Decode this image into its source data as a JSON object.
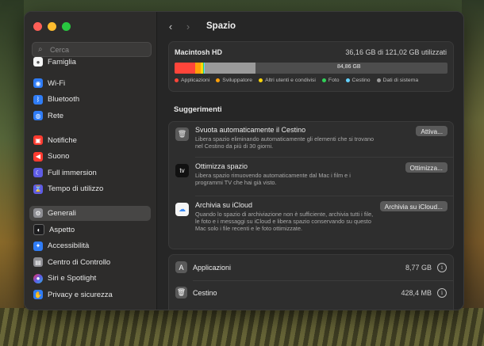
{
  "sidebar": {
    "search_placeholder": "Cerca",
    "items": [
      {
        "label": "Famiglia",
        "icon": "family-icon",
        "color": "#f5f5f5",
        "glyph": "👥"
      },
      {
        "label": "Wi-Fi",
        "icon": "wifi-icon",
        "color": "#2f7cf6",
        "glyph": "◉"
      },
      {
        "label": "Bluetooth",
        "icon": "bluetooth-icon",
        "color": "#2f7cf6",
        "glyph": "ᛒ"
      },
      {
        "label": "Rete",
        "icon": "network-icon",
        "color": "#2f7cf6",
        "glyph": "◍"
      },
      {
        "label": "Notifiche",
        "icon": "notifications-icon",
        "color": "#ff3b30",
        "glyph": "▣"
      },
      {
        "label": "Suono",
        "icon": "sound-icon",
        "color": "#ff3b30",
        "glyph": "◀"
      },
      {
        "label": "Full immersion",
        "icon": "focus-icon",
        "color": "#5e5ce6",
        "glyph": "☾"
      },
      {
        "label": "Tempo di utilizzo",
        "icon": "screen-time-icon",
        "color": "#5e5ce6",
        "glyph": "⌛"
      },
      {
        "label": "Generali",
        "icon": "gear-icon",
        "color": "#8e8e93",
        "glyph": "⚙"
      },
      {
        "label": "Aspetto",
        "icon": "appearance-icon",
        "color": "#1c1c1e",
        "glyph": "◐"
      },
      {
        "label": "Accessibilità",
        "icon": "accessibility-icon",
        "color": "#2f7cf6",
        "glyph": "♿"
      },
      {
        "label": "Centro di Controllo",
        "icon": "control-center-icon",
        "color": "#8e8e93",
        "glyph": "▤"
      },
      {
        "label": "Siri e Spotlight",
        "icon": "siri-icon",
        "color": "#b44cd6",
        "glyph": "●"
      },
      {
        "label": "Privacy e sicurezza",
        "icon": "privacy-icon",
        "color": "#2f7cf6",
        "glyph": "✋"
      }
    ]
  },
  "header": {
    "title": "Spazio"
  },
  "disk": {
    "name": "Macintosh HD",
    "usage": "36,16 GB di 121,02 GB utilizzati",
    "free_label": "84,86 GB",
    "segments": [
      {
        "name": "Applicazioni",
        "color": "#ff453a",
        "fraction": 0.075
      },
      {
        "name": "Sviluppatore",
        "color": "#ff9f0a",
        "fraction": 0.022
      },
      {
        "name": "Altri utenti e condivisi",
        "color": "#ffd60a",
        "fraction": 0.008
      },
      {
        "name": "Foto",
        "color": "#30d158",
        "fraction": 0.002
      },
      {
        "name": "Cestino",
        "color": "#64d2ff",
        "fraction": 0.004
      },
      {
        "name": "Dati di sistema",
        "color": "#9a9a9a",
        "fraction": 0.187
      }
    ]
  },
  "suggestions": {
    "title": "Suggerimenti",
    "items": [
      {
        "title": "Svuota automaticamente il Cestino",
        "desc": "Libera spazio eliminando automaticamente gli elementi che si trovano nel Cestino da più di 30 giorni.",
        "button": "Attiva...",
        "icon": "trash-icon"
      },
      {
        "title": "Ottimizza spazio",
        "desc": "Libera spazio rimuovendo automaticamente dal Mac i film e i programmi TV che hai già visto.",
        "button": "Ottimizza...",
        "icon": "apple-tv-icon",
        "icon_text": "tv"
      },
      {
        "title": "Archivia su iCloud",
        "desc": "Quando lo spazio di archiviazione non è sufficiente, archivia tutti i file, le foto e i messaggi su iCloud e libera spazio conservando su questo Mac solo i file recenti e le foto ottimizzate.",
        "button": "Archivia su iCloud...",
        "icon": "icloud-icon"
      }
    ]
  },
  "categories": [
    {
      "label": "Applicazioni",
      "size": "8,77 GB",
      "icon": "app-store-icon"
    },
    {
      "label": "Cestino",
      "size": "428,4 MB",
      "icon": "trash-icon"
    }
  ]
}
